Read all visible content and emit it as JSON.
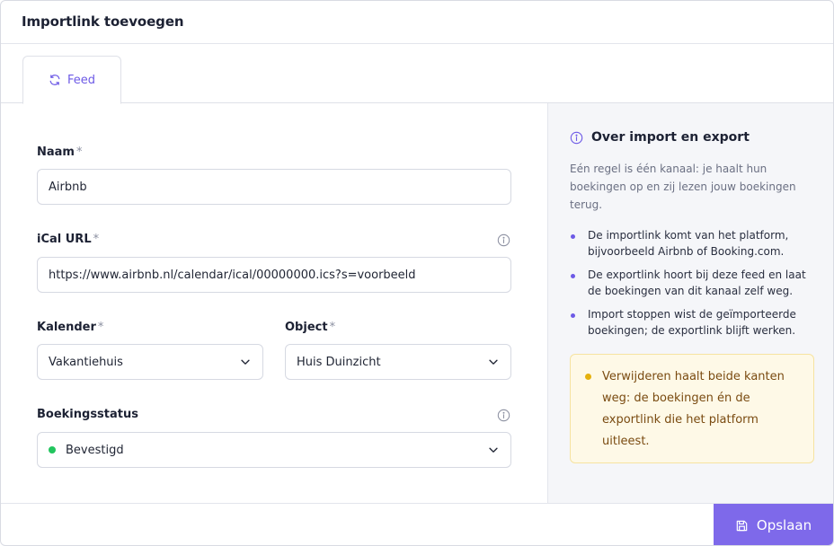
{
  "header": {
    "title": "Importlink toevoegen"
  },
  "tabs": [
    {
      "label": "Feed",
      "icon": "refresh-icon",
      "active": true
    }
  ],
  "form": {
    "required_marker": "*",
    "name": {
      "label": "Naam",
      "value": "Airbnb"
    },
    "ical": {
      "label": "iCal URL",
      "value": "https://www.airbnb.nl/calendar/ical/00000000.ics?s=voorbeeld"
    },
    "calendar": {
      "label": "Kalender",
      "value": "Vakantiehuis"
    },
    "object": {
      "label": "Object",
      "value": "Huis Duinzicht"
    },
    "status": {
      "label": "Boekingsstatus",
      "value": "Bevestigd",
      "dot_color": "#22c55e"
    }
  },
  "aside": {
    "title": "Over import en export",
    "intro": "Eén regel is één kanaal: je haalt hun boekingen op en zij lezen jouw boekingen terug.",
    "bullets": [
      "De importlink komt van het platform, bijvoorbeeld Airbnb of Booking.com.",
      "De exportlink hoort bij deze feed en laat de boekingen van dit kanaal zelf weg.",
      "Import stoppen wist de geïmporteerde boekingen; de exportlink blijft werken."
    ],
    "warning": "Verwijderen haalt beide kanten weg: de boekingen én de exportlink die het platform uitleest."
  },
  "footer": {
    "save_label": "Opslaan"
  },
  "colors": {
    "accent": "#7e69ea",
    "tab_text": "#6d5ae6",
    "warning_bg": "#fef9e7",
    "warning_dot": "#e5b10d"
  }
}
